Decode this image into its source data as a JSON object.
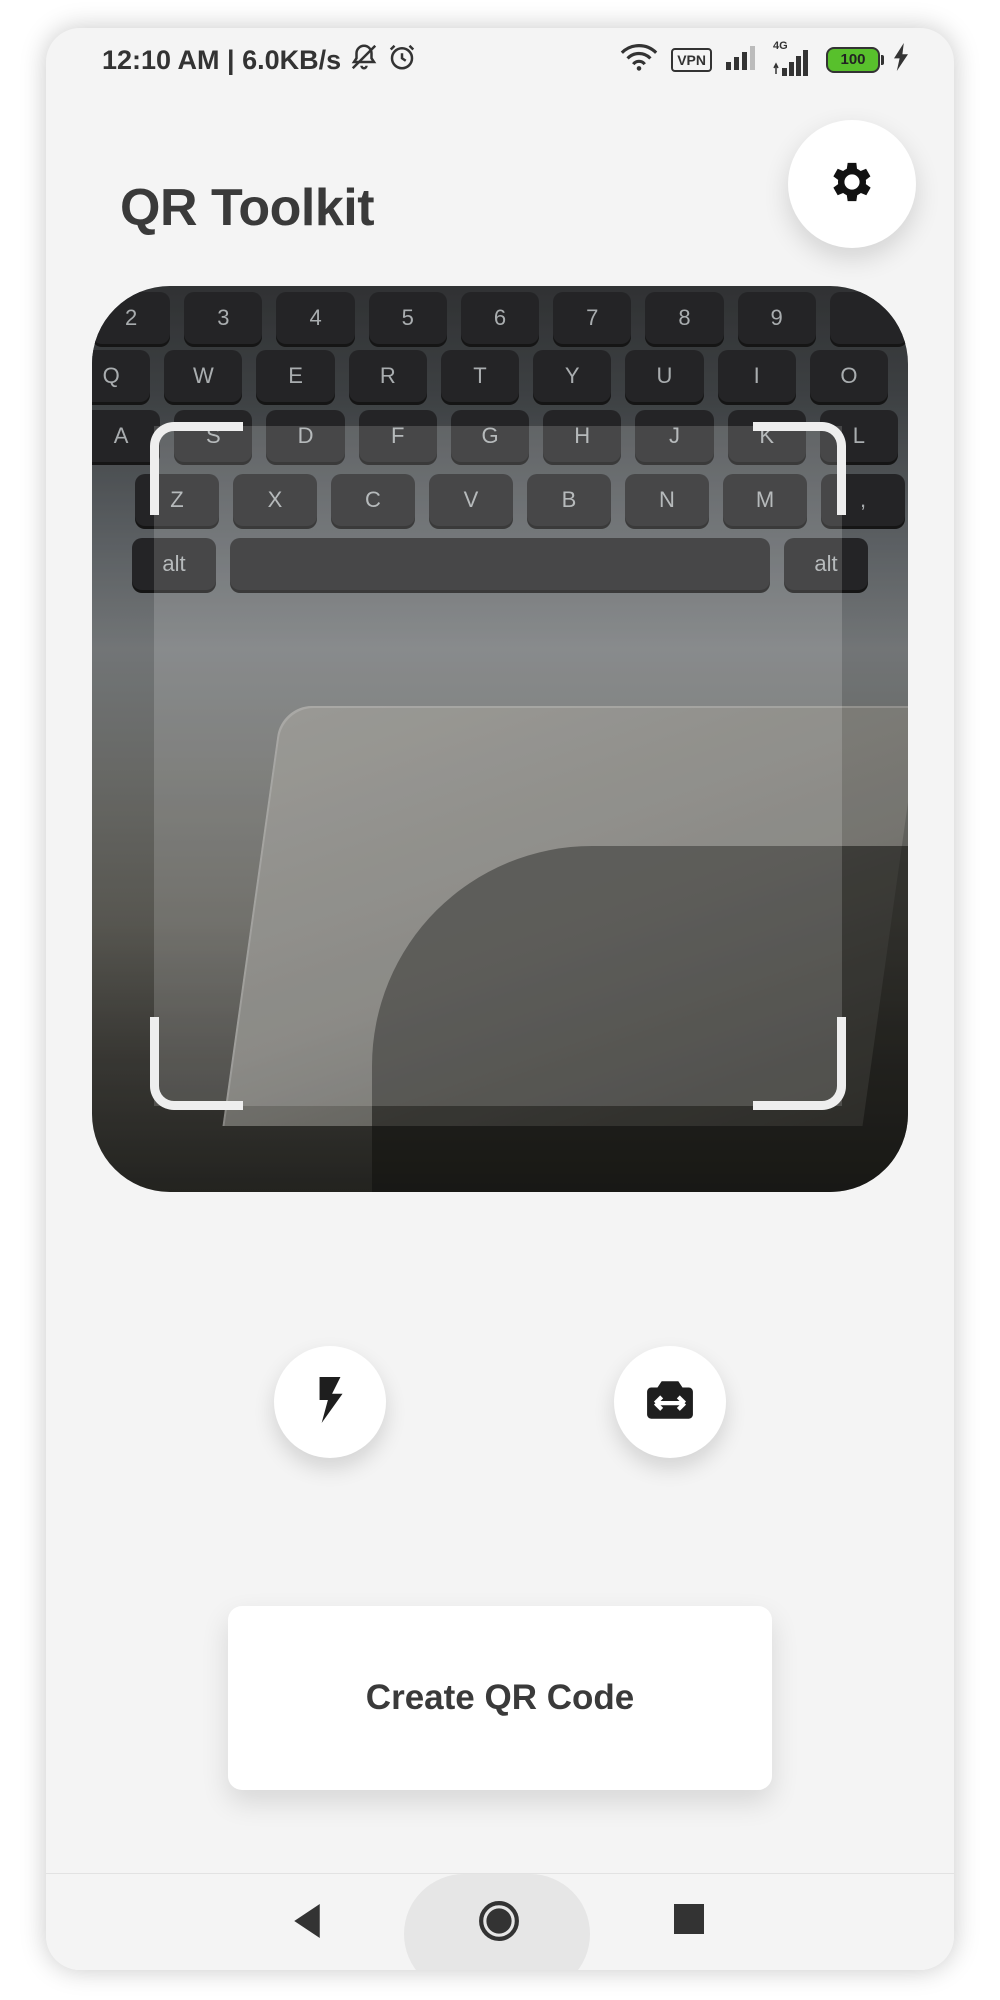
{
  "status_bar": {
    "time_speed": "12:10 AM | 6.0KB/s",
    "icons": [
      "bell-muted-icon",
      "alarm-icon",
      "wifi-icon",
      "signal-icon",
      "signal-4g-icon",
      "charging-icon"
    ],
    "vpn_label": "VPN",
    "network_label": "4G",
    "battery_level": "100",
    "battery_color": "#58c02c"
  },
  "header": {
    "title": "QR Toolkit",
    "settings_icon": "gear-icon"
  },
  "camera": {
    "keys_row1": [
      "2",
      "3",
      "4",
      "5",
      "6",
      "7",
      "8",
      "9",
      ""
    ],
    "keys_row2": [
      "Q",
      "W",
      "E",
      "R",
      "T",
      "Y",
      "U",
      "I",
      "O"
    ],
    "keys_row3": [
      "A",
      "S",
      "D",
      "F",
      "G",
      "H",
      "J",
      "K",
      "L"
    ],
    "keys_row4": [
      "Z",
      "X",
      "C",
      "V",
      "B",
      "N",
      "M",
      ","
    ],
    "key_alt_left": "alt",
    "key_alt_right": "alt"
  },
  "controls": {
    "flash_icon": "flash-icon",
    "switch_camera_icon": "switch-camera-icon"
  },
  "main": {
    "create_button_label": "Create QR Code"
  },
  "nav_bar": {
    "items": [
      "back-icon",
      "home-icon",
      "recents-icon"
    ]
  }
}
